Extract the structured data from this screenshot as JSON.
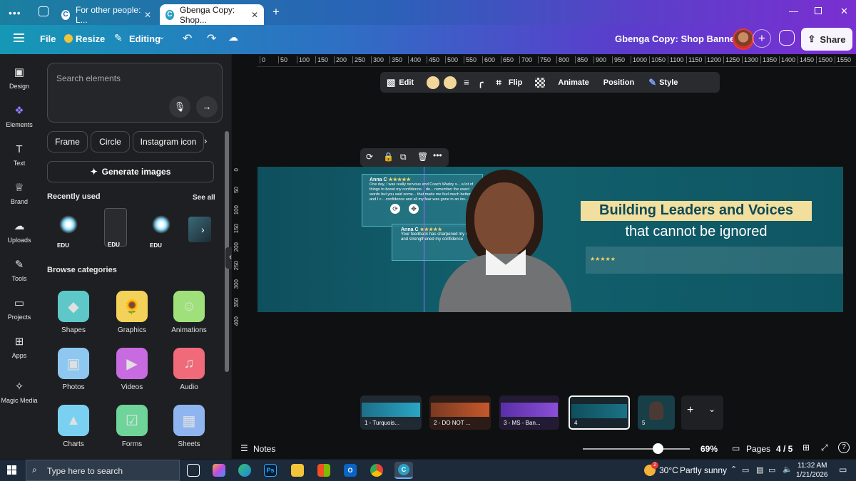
{
  "browser": {
    "tabs": [
      {
        "label": "For other people: L..."
      },
      {
        "label": "Gbenga Copy: Shop..."
      }
    ],
    "new_tab": "+"
  },
  "topbar": {
    "file_label": "File",
    "resize_label": "Resize",
    "editing_label": "Editing",
    "doc_title": "Gbenga Copy: Shop Banners",
    "share_label": "Share"
  },
  "rail": {
    "items": [
      {
        "label": "Design",
        "icon": "design-icon"
      },
      {
        "label": "Elements",
        "icon": "elements-icon"
      },
      {
        "label": "Text",
        "icon": "text-icon"
      },
      {
        "label": "Brand",
        "icon": "brand-icon"
      },
      {
        "label": "Uploads",
        "icon": "uploads-icon"
      },
      {
        "label": "Tools",
        "icon": "tools-icon"
      },
      {
        "label": "Projects",
        "icon": "projects-icon"
      },
      {
        "label": "Apps",
        "icon": "apps-icon"
      },
      {
        "label": "Magic Media",
        "icon": "magic-media-icon"
      }
    ]
  },
  "panel": {
    "search_placeholder": "Search elements",
    "chips": [
      "Frame",
      "Circle",
      "Instagram icon"
    ],
    "generate_label": "Generate images",
    "recently_used_title": "Recently used",
    "see_all": "See all",
    "recent_badges": [
      "EDU",
      "EDU",
      "EDU"
    ],
    "browse_title": "Browse categories",
    "categories": [
      {
        "label": "Shapes",
        "color": "#5ec8c9"
      },
      {
        "label": "Graphics",
        "color": "#f4d25a"
      },
      {
        "label": "Animations",
        "color": "#9fe07a"
      },
      {
        "label": "Photos",
        "color": "#8ec8f0"
      },
      {
        "label": "Videos",
        "color": "#c86be0"
      },
      {
        "label": "Audio",
        "color": "#f06a7a"
      },
      {
        "label": "Charts",
        "color": "#7ad0f0"
      },
      {
        "label": "Forms",
        "color": "#6fd49a"
      },
      {
        "label": "Sheets",
        "color": "#8fb5f0"
      }
    ]
  },
  "ruler_top": [
    "0",
    "50",
    "100",
    "150",
    "200",
    "250",
    "300",
    "350",
    "400",
    "450",
    "500",
    "550",
    "600",
    "650",
    "700",
    "750",
    "800",
    "850",
    "900",
    "950",
    "1000",
    "1050",
    "1100",
    "1150",
    "1200",
    "1250",
    "1300",
    "1350",
    "1400",
    "1450",
    "1500",
    "1550"
  ],
  "ruler_left": [
    "0",
    "50",
    "100",
    "150",
    "200",
    "250",
    "300",
    "350",
    "400"
  ],
  "floatbar": {
    "edit": "Edit",
    "flip": "Flip",
    "animate": "Animate",
    "position": "Position",
    "style": "Style"
  },
  "banner": {
    "heading_line1": "Building Leaders and Voices",
    "heading_line2": "that cannot be ignored",
    "stars": "★★★★★",
    "review1_name": "Anna C",
    "review1_text": "One day, I was really nervous and Coach Wadzy s... a lot of things to boost my confidence. I do... remember the exact words but you said some... that made me feel much better and I c... confidence and all my fear was gone in an ins...",
    "review2_name": "Anna C",
    "review2_text": "Your feedback has sharpened my voice and strengthened my confidence"
  },
  "pages": [
    {
      "label": "1 - Turquois..."
    },
    {
      "label": "2 - DO NOT ..."
    },
    {
      "label": "3 - MS - Ban..."
    },
    {
      "label": "4"
    },
    {
      "label": "5"
    }
  ],
  "bottombar": {
    "notes": "Notes",
    "zoom": "69%",
    "zoom_fraction": 0.7,
    "pages_label": "Pages",
    "page_count": "4 / 5"
  },
  "taskbar": {
    "search_placeholder": "Type here to search",
    "weather_temp": "30°C",
    "weather_desc": "Partly sunny",
    "time": "11:32 AM",
    "date": "1/21/2026",
    "weather_badge": "2"
  }
}
